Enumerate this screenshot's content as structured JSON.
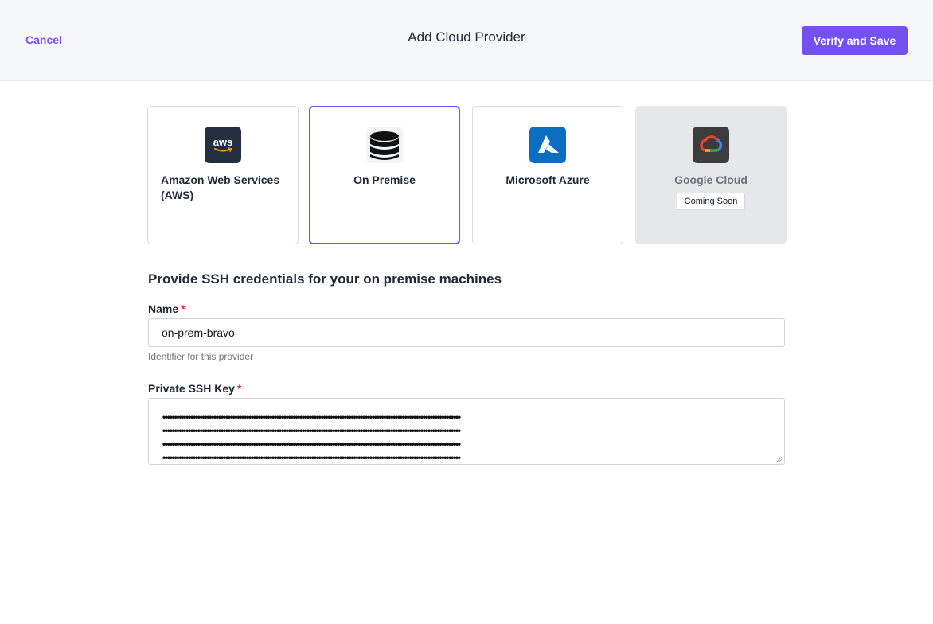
{
  "header": {
    "cancel_label": "Cancel",
    "title": "Add Cloud Provider",
    "verify_label": "Verify and Save"
  },
  "providers": [
    {
      "name": "Amazon Web Services (AWS)",
      "icon": "aws-logo-icon",
      "logo_text": "aws",
      "state": "default"
    },
    {
      "name": "On Premise",
      "icon": "database-icon",
      "state": "selected"
    },
    {
      "name": "Microsoft Azure",
      "icon": "azure-logo-icon",
      "state": "default"
    },
    {
      "name": "Google Cloud",
      "icon": "google-cloud-logo-icon",
      "state": "disabled",
      "badge": "Coming Soon"
    }
  ],
  "form": {
    "section_title": "Provide SSH credentials for your on premise machines",
    "name_label": "Name",
    "required_marker": "*",
    "name_value": "on-prem-bravo",
    "name_hint": "Identifier for this provider",
    "ssh_key_label": "Private SSH Key",
    "ssh_key_masked": "••••••••••••••••••••••••••••••••••••••••••••••••••••••••••••••••••••••••••••••••••••••••••••••••••••••••••••••••••••••••••••••••"
  },
  "colors": {
    "accent": "#7450f0",
    "required": "#e0243a",
    "azure_blue": "#0a6fc2",
    "aws_dark": "#232f3e"
  }
}
